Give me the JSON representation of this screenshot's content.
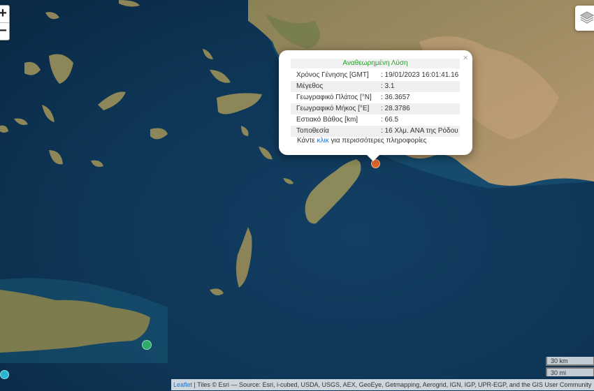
{
  "map_controls": {
    "zoom_in": "+",
    "zoom_out": "−",
    "layers_icon": "layers-icon"
  },
  "popup": {
    "title": "Αναθεωρημένη Λύση",
    "close": "×",
    "rows": [
      {
        "key": "Χρόνος Γένησης [GMT]",
        "value": ": 19/01/2023 16:01:41.16"
      },
      {
        "key": "Μέγεθος",
        "value": ": 3.1"
      },
      {
        "key": "Γεωγραφικό Πλάτος [°N]",
        "value": ": 36.3657"
      },
      {
        "key": "Γεωγραφικό Μήκος [°E]",
        "value": ": 28.3786"
      },
      {
        "key": "Εστιακό Βάθος [km]",
        "value": ": 66.5"
      },
      {
        "key": "Τοποθεσία",
        "value": ": 16 Χλμ. ΑΝΑ της Ρόδου"
      }
    ],
    "more_prefix": "Κάντε ",
    "more_link": "κλικ",
    "more_suffix": " για περισσότερες πληροφορίες"
  },
  "markers": {
    "colors": {
      "selected": "#e0662a",
      "green": "#2eaa6a",
      "cyan": "#26b7d0"
    }
  },
  "scale": {
    "km": "30 km",
    "mi": "30 mi"
  },
  "attribution": {
    "leaflet": "Leaflet",
    "text": " | Tiles © Esri — Source: Esri, i-cubed, USDA, USGS, AEX, GeoEye, Getmapping, Aerogrid, IGN, IGP, UPR-EGP, and the GIS User Community"
  }
}
